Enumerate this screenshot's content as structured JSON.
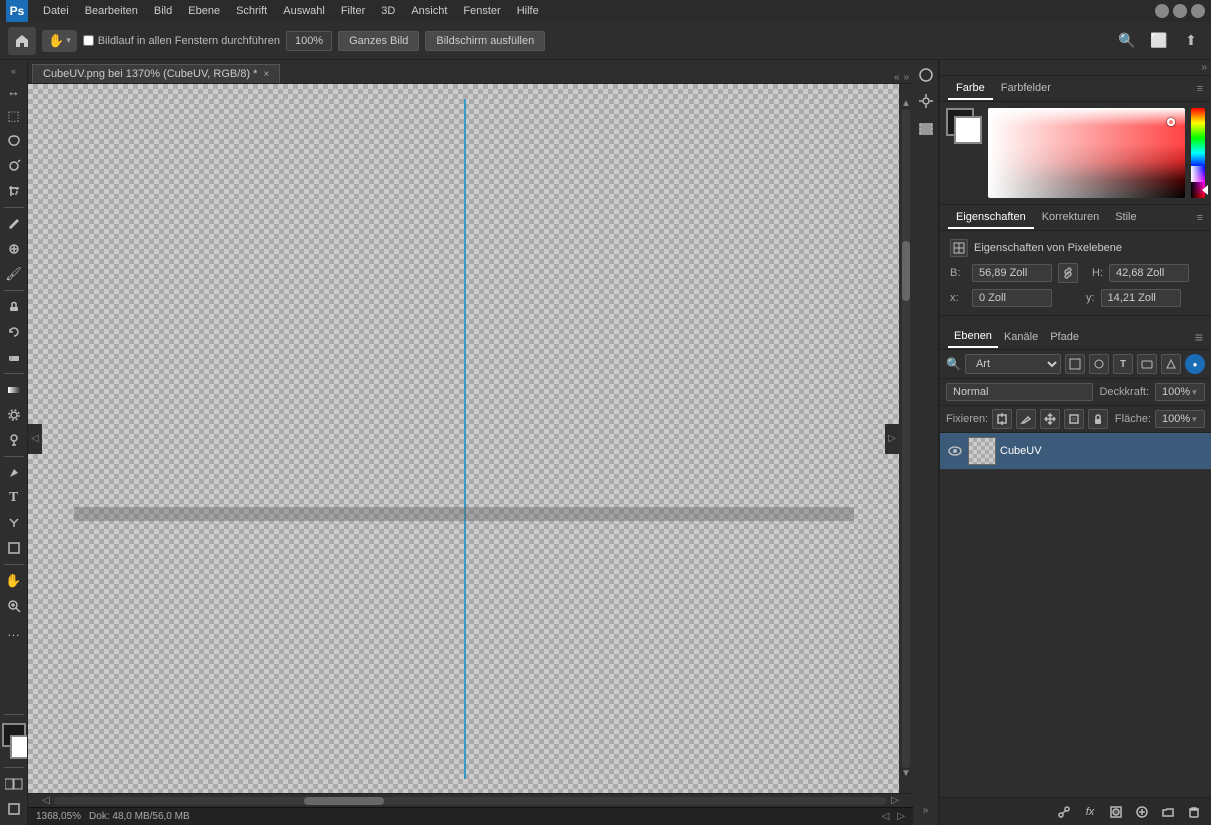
{
  "app": {
    "title": "Adobe Photoshop"
  },
  "menubar": {
    "logo": "Ps",
    "items": [
      "Datei",
      "Bearbeiten",
      "Bild",
      "Ebene",
      "Schrift",
      "Auswahl",
      "Filter",
      "3D",
      "Ansicht",
      "Fenster",
      "Hilfe"
    ]
  },
  "toolbar": {
    "checkbox_label": "Bildlauf in allen Fenstern durchführen",
    "zoom_value": "100%",
    "btn_whole_image": "Ganzes Bild",
    "btn_fill_screen": "Bildschirm ausfüllen"
  },
  "document": {
    "tab_title": "CubeUV.png bei 1370% (CubeUV, RGB/8) *",
    "tab_close": "×"
  },
  "status_bar": {
    "zoom": "1368,05%",
    "doc_size": "Dok: 48,0 MB/56,0 MB"
  },
  "right_panel": {
    "collapse_arrow": "»"
  },
  "color_panel": {
    "tab_color": "Farbe",
    "tab_swatches": "Farbfelder",
    "menu_icon": "≡"
  },
  "properties_panel": {
    "tab_properties": "Eigenschaften",
    "tab_corrections": "Korrekturen",
    "tab_styles": "Stile",
    "menu_icon": "≡",
    "title": "Eigenschaften von Pixelebene",
    "b_label": "B:",
    "b_value": "56,89 Zoll",
    "h_label": "H:",
    "h_value": "42,68 Zoll",
    "x_label": "x:",
    "x_value": "0 Zoll",
    "y_label": "y:",
    "y_value": "14,21 Zoll",
    "link_icon": "🔗"
  },
  "layers_panel": {
    "tab_layers": "Ebenen",
    "tab_channels": "Kanäle",
    "tab_paths": "Pfade",
    "menu_icon": "≡",
    "search_placeholder": "Art",
    "blend_mode": "Normal",
    "opacity_label": "Deckkraft:",
    "opacity_value": "100%",
    "fix_label": "Fixieren:",
    "area_label": "Fläche:",
    "area_value": "100%",
    "layers": [
      {
        "name": "CubeUV",
        "visible": true
      }
    ],
    "bottom_icons": [
      "🔗",
      "fx",
      "⬜",
      "⚙",
      "📁",
      "🗑"
    ]
  },
  "tools": [
    {
      "icon": "↔",
      "name": "move-tool"
    },
    {
      "icon": "⬚",
      "name": "selection-rect-tool"
    },
    {
      "icon": "✂",
      "name": "lasso-tool"
    },
    {
      "icon": "⬚",
      "name": "quick-select-tool"
    },
    {
      "icon": "✂",
      "name": "crop-tool"
    },
    {
      "icon": "⬙",
      "name": "eyedropper-tool"
    },
    {
      "icon": "✏",
      "name": "healing-brush-tool"
    },
    {
      "icon": "🖌",
      "name": "brush-tool"
    },
    {
      "icon": "◪",
      "name": "stamp-tool"
    },
    {
      "icon": "↩",
      "name": "history-brush-tool"
    },
    {
      "icon": "⌫",
      "name": "eraser-tool"
    },
    {
      "icon": "▓",
      "name": "gradient-tool"
    },
    {
      "icon": "◉",
      "name": "blur-tool"
    },
    {
      "icon": "☝",
      "name": "dodge-tool"
    },
    {
      "icon": "✍",
      "name": "pen-tool"
    },
    {
      "icon": "T",
      "name": "type-tool"
    },
    {
      "icon": "⬡",
      "name": "path-select-tool"
    },
    {
      "icon": "⬜",
      "name": "shape-tool"
    },
    {
      "icon": "✋",
      "name": "hand-tool"
    },
    {
      "icon": "⊕",
      "name": "zoom-tool"
    },
    {
      "icon": "…",
      "name": "more-tools"
    }
  ]
}
